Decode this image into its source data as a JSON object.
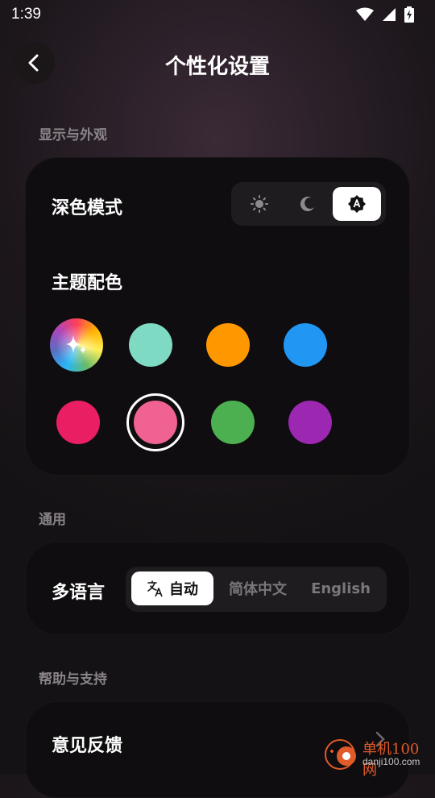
{
  "status": {
    "time": "1:39"
  },
  "header": {
    "title": "个性化设置"
  },
  "display": {
    "section_label": "显示与外观",
    "dark_mode_label": "深色模式",
    "dark_mode_options": [
      "light-mode",
      "dark-mode",
      "auto-mode"
    ],
    "dark_mode_selected": "auto-mode",
    "theme_label": "主题配色",
    "theme_colors": [
      "rainbow",
      "#7fdac4",
      "#ff9800",
      "#2196f3",
      "#e91e63",
      "#f06292",
      "#4caf50",
      "#9c27b0"
    ],
    "theme_selected": "#f06292"
  },
  "general": {
    "section_label": "通用",
    "language_label": "多语言",
    "language_options": {
      "auto": "自动",
      "zh": "简体中文",
      "en": "English"
    },
    "language_selected": "auto"
  },
  "help": {
    "section_label": "帮助与支持",
    "feedback_label": "意见反馈"
  },
  "watermark": {
    "site_cn": "单机100网",
    "site_url": "danji100.com"
  }
}
